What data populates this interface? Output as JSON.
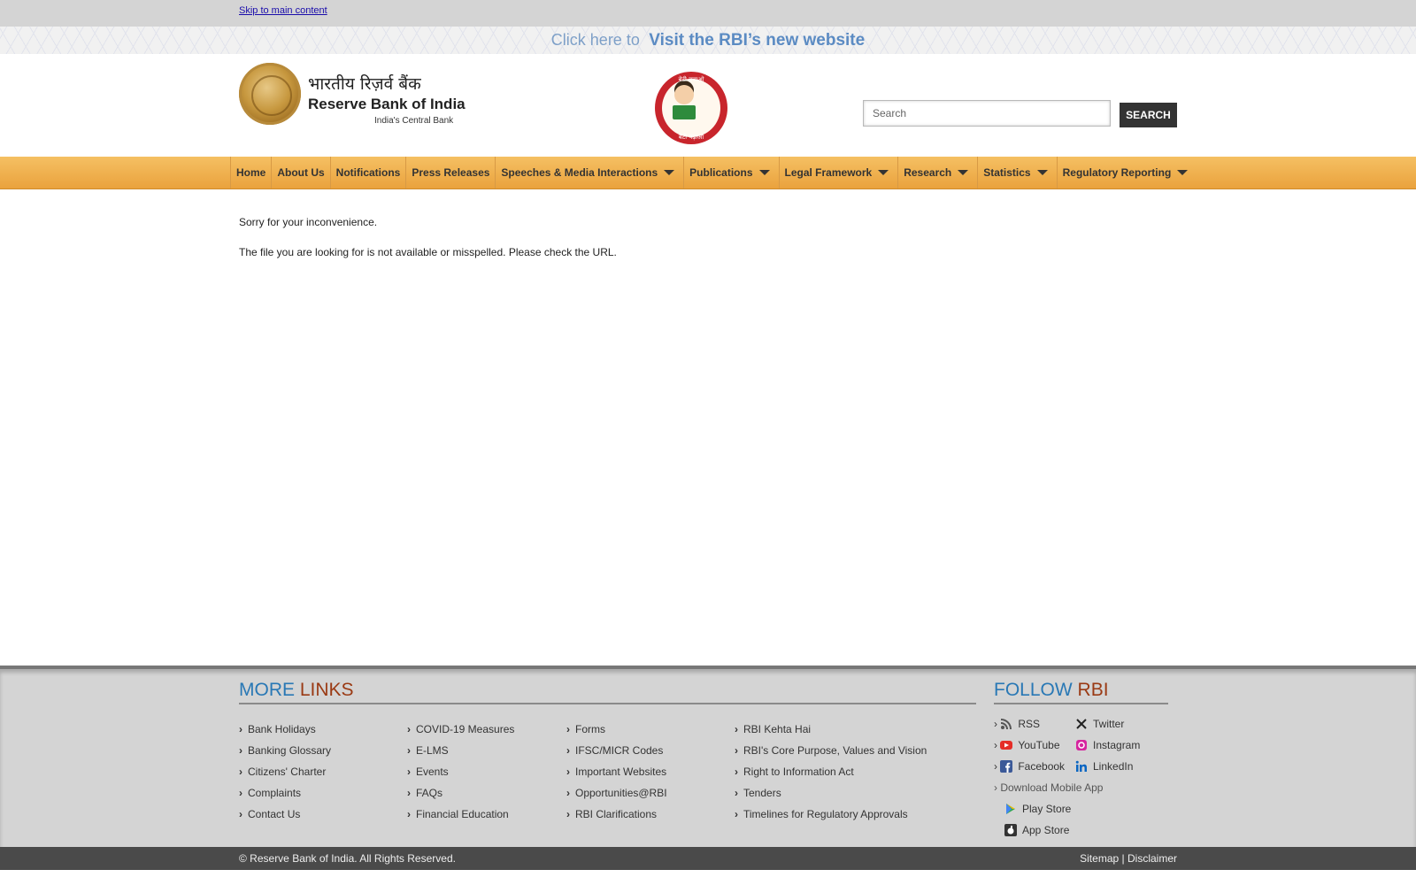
{
  "topbar": {
    "skip_link": "Skip to main content"
  },
  "banner": {
    "click_here": "Click here to",
    "visit": "Visit the RBI’s new website"
  },
  "header": {
    "logo_hindi": "भारतीय रिज़र्व बैंक",
    "logo_english": "Reserve Bank of India",
    "logo_tagline": "India's Central Bank",
    "campaign_text_top": "बेटी बचाओ",
    "campaign_text_bottom": "बेटी पढ़ाओ",
    "search_placeholder": "Search",
    "search_button": "SEARCH"
  },
  "nav": {
    "items": [
      {
        "label": "Home",
        "dropdown": false
      },
      {
        "label": "About Us",
        "dropdown": false
      },
      {
        "label": "Notifications",
        "dropdown": false
      },
      {
        "label": "Press Releases",
        "dropdown": false
      },
      {
        "label": "Speeches & Media Interactions",
        "dropdown": true
      },
      {
        "label": "Publications",
        "dropdown": true
      },
      {
        "label": "Legal Framework",
        "dropdown": true
      },
      {
        "label": "Research",
        "dropdown": true
      },
      {
        "label": "Statistics",
        "dropdown": true
      },
      {
        "label": "Regulatory Reporting",
        "dropdown": true
      }
    ]
  },
  "main": {
    "line1": "Sorry for your inconvenience.",
    "line2": "The file you are looking for is not available or misspelled. Please check the URL."
  },
  "footer": {
    "more_links_a": "MORE",
    "more_links_b": "LINKS",
    "follow_a": "FOLLOW",
    "follow_b": "RBI",
    "columns": [
      [
        "Bank Holidays",
        "Banking Glossary",
        "Citizens' Charter",
        "Complaints",
        "Contact Us"
      ],
      [
        "COVID-19 Measures",
        "E-LMS",
        "Events",
        "FAQs",
        "Financial Education"
      ],
      [
        "Forms",
        "IFSC/MICR Codes",
        "Important Websites",
        "Opportunities@RBI",
        "RBI Clarifications"
      ],
      [
        "RBI Kehta Hai",
        "RBI's Core Purpose, Values and Vision",
        "Right to Information Act",
        "Tenders",
        "Timelines for Regulatory Approvals"
      ]
    ],
    "social": {
      "rss": "RSS",
      "twitter": "Twitter",
      "youtube": "YouTube",
      "instagram": "Instagram",
      "facebook": "Facebook",
      "linkedin": "LinkedIn",
      "download": "Download Mobile App",
      "play_store": "Play Store",
      "app_store": "App Store"
    },
    "colors": {
      "blue": "#2978b5",
      "brown": "#9a3a14",
      "nav_orange": "#f0ad4e"
    }
  },
  "bottom": {
    "copyright": "© Reserve Bank of India. All Rights Reserved.",
    "sitemap": "Sitemap",
    "separator": "|",
    "disclaimer": "Disclaimer"
  }
}
